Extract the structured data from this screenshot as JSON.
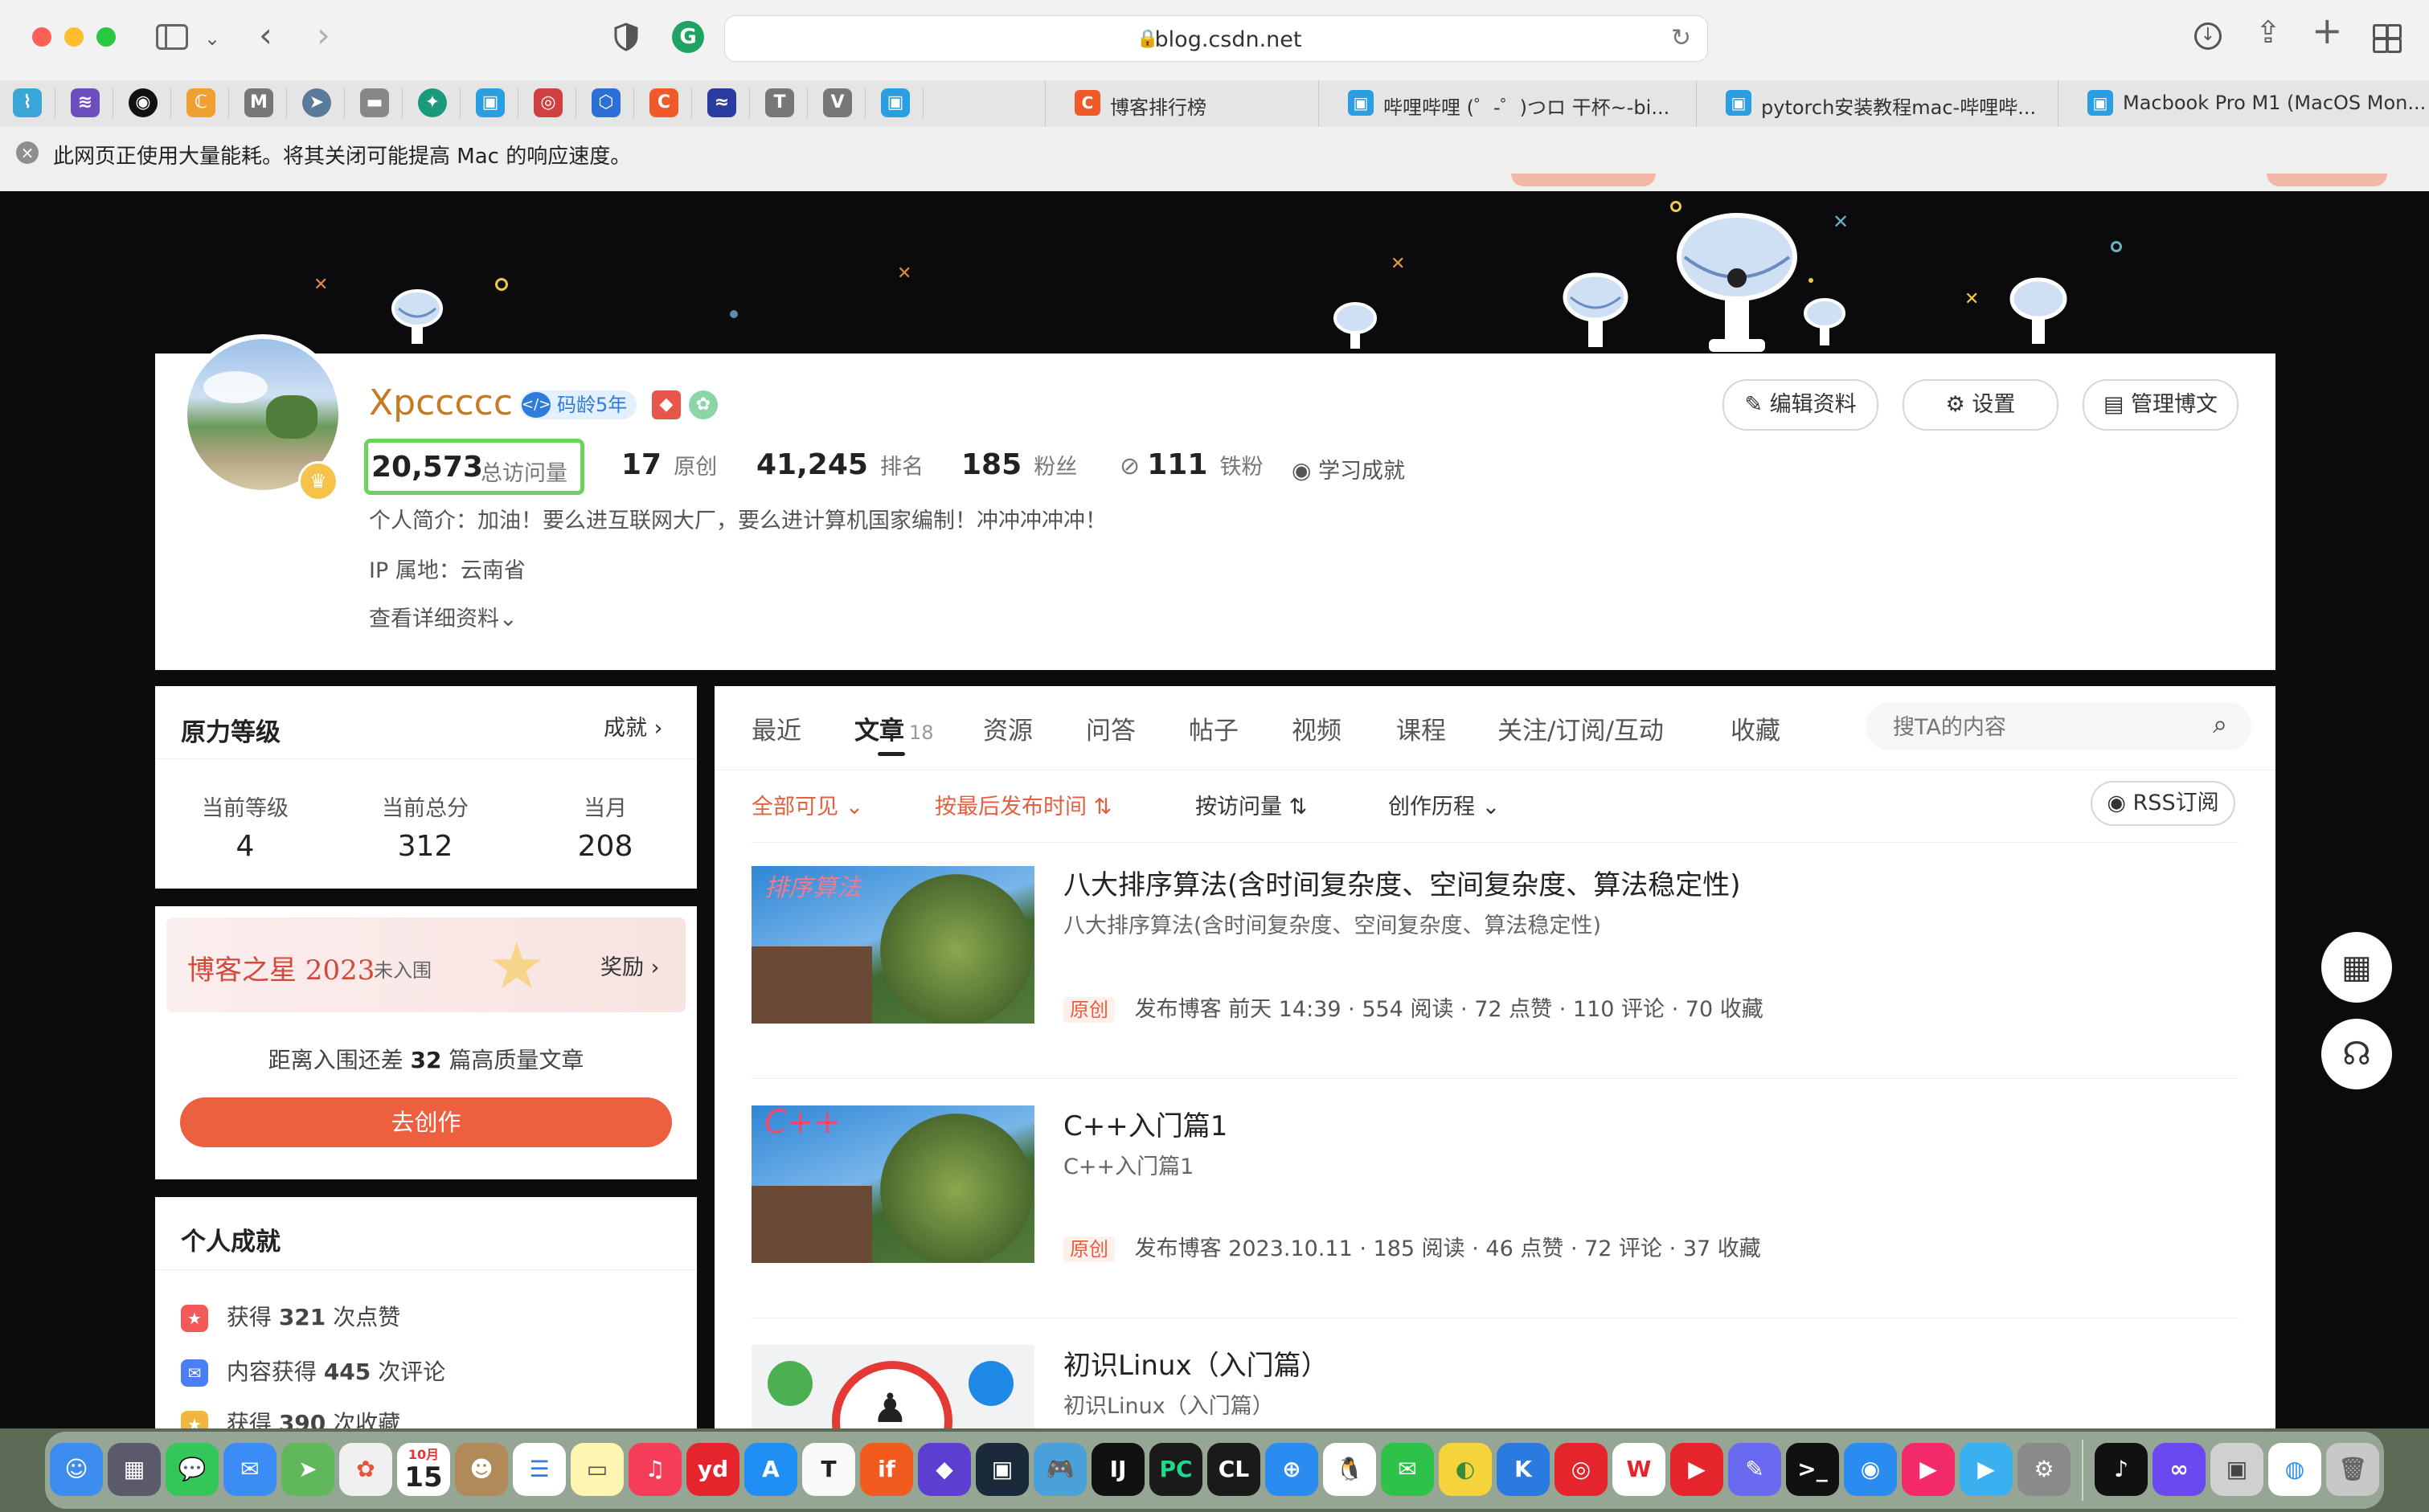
{
  "browser": {
    "url": "blog.csdn.net",
    "warning": "此网页正使用大量能耗。将其关闭可能提高 Mac 的响应速度。",
    "tabs": [
      {
        "title": "博客排行榜",
        "icon": "csdn-icon"
      },
      {
        "title": "哔哩哔哩 (゜-゜)つロ 干杯~-bi...",
        "icon": "bilibili-icon"
      },
      {
        "title": "pytorch安装教程mac-哔哩哔...",
        "icon": "bilibili-icon"
      },
      {
        "title": "Macbook Pro M1 (MacOS Mon...",
        "icon": "bilibili-icon"
      }
    ],
    "pinned": [
      "T",
      "V"
    ]
  },
  "profile": {
    "name": "Xpccccc",
    "badge": "码龄5年",
    "stats": [
      {
        "value": "20,573",
        "label": "总访问量"
      },
      {
        "value": "17",
        "label": "原创"
      },
      {
        "value": "41,245",
        "label": "排名"
      },
      {
        "value": "185",
        "label": "粉丝"
      },
      {
        "value": "111",
        "label": "铁粉"
      }
    ],
    "achievements_link": "学习成就",
    "intro": "个人简介：加油！要么进互联网大厂，要么进计算机国家编制！冲冲冲冲冲！",
    "ip": "IP 属地：云南省",
    "details_link": "查看详细资料",
    "buttons": {
      "edit": "编辑资料",
      "settings": "设置",
      "manage": "管理博文"
    }
  },
  "level_card": {
    "title": "原力等级",
    "link": "成就",
    "items": [
      {
        "label": "当前等级",
        "value": "4"
      },
      {
        "label": "当前总分",
        "value": "312"
      },
      {
        "label": "当月",
        "value": "208"
      }
    ]
  },
  "star_card": {
    "title": "博客之星 2023",
    "status": "未入围",
    "link": "奖励",
    "gap_prefix": "距离入围还差",
    "gap_num": "32",
    "gap_suffix": "篇高质量文章",
    "cta": "去创作"
  },
  "achieve_card": {
    "title": "个人成就",
    "items": [
      {
        "prefix": "获得",
        "num": "321",
        "suffix": "次点赞"
      },
      {
        "prefix": "内容获得",
        "num": "445",
        "suffix": "次评论"
      },
      {
        "prefix": "获得",
        "num": "390",
        "suffix": "次收藏"
      }
    ]
  },
  "content": {
    "tabs": [
      "最近",
      "文章",
      "资源",
      "问答",
      "帖子",
      "视频",
      "课程",
      "关注/订阅/互动",
      "收藏"
    ],
    "article_count": "18",
    "search_placeholder": "搜TA的内容",
    "filters": {
      "visibility": "全部可见",
      "sort_time": "按最后发布时间",
      "sort_views": "按访问量",
      "history": "创作历程",
      "rss": "RSS订阅"
    },
    "articles": [
      {
        "title": "八大排序算法(含时间复杂度、空间复杂度、算法稳定性)",
        "sub": "八大排序算法(含时间复杂度、空间复杂度、算法稳定性)",
        "thumb_text": "排序算法",
        "tag": "原创",
        "date": "发布博客 前天 14:39",
        "reads": "554 阅读",
        "likes": "72 点赞",
        "comments": "110 评论",
        "favs": "70 收藏"
      },
      {
        "title": "C++入门篇1",
        "sub": "C++入门篇1",
        "thumb_text": "C++",
        "tag": "原创",
        "date": "发布博客 2023.10.11",
        "reads": "185 阅读",
        "likes": "46 点赞",
        "comments": "72 评论",
        "favs": "37 收藏"
      },
      {
        "title": "初识Linux（入门篇）",
        "sub": "初识Linux（入门篇）"
      }
    ]
  },
  "dock": {
    "calendar_month": "10月",
    "calendar_day": "15"
  }
}
